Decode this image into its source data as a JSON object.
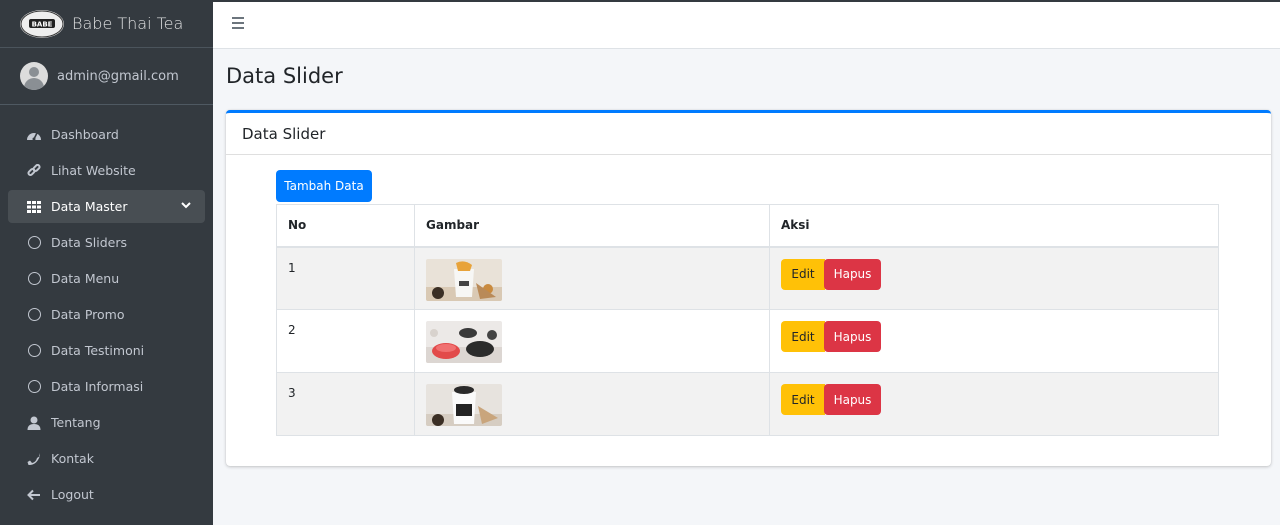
{
  "brand": {
    "name": "Babe Thai Tea",
    "logo_text": "BABE"
  },
  "user": {
    "email": "admin@gmail.com"
  },
  "sidebar": {
    "items": [
      {
        "label": "Dashboard",
        "icon": "tachometer-icon"
      },
      {
        "label": "Lihat Website",
        "icon": "link-icon"
      },
      {
        "label": "Data Master",
        "icon": "grid-icon",
        "active": true
      },
      {
        "label": "Data Sliders",
        "icon": "circle-icon"
      },
      {
        "label": "Data Menu",
        "icon": "circle-icon"
      },
      {
        "label": "Data Promo",
        "icon": "circle-icon"
      },
      {
        "label": "Data Testimoni",
        "icon": "circle-icon"
      },
      {
        "label": "Data Informasi",
        "icon": "circle-icon"
      },
      {
        "label": "Tentang",
        "icon": "user-icon"
      },
      {
        "label": "Kontak",
        "icon": "phone-icon"
      },
      {
        "label": "Logout",
        "icon": "arrow-left-icon"
      }
    ]
  },
  "page": {
    "title": "Data Slider"
  },
  "card": {
    "title": "Data Slider",
    "add_button": "Tambah Data",
    "table": {
      "headers": [
        "No",
        "Gambar",
        "Aksi"
      ],
      "rows": [
        {
          "no": "1",
          "edit": "Edit",
          "delete": "Hapus"
        },
        {
          "no": "2",
          "edit": "Edit",
          "delete": "Hapus"
        },
        {
          "no": "3",
          "edit": "Edit",
          "delete": "Hapus"
        }
      ]
    }
  },
  "colors": {
    "primary": "#007bff",
    "warning": "#ffc107",
    "danger": "#dc3545",
    "sidebar": "#343a40"
  }
}
